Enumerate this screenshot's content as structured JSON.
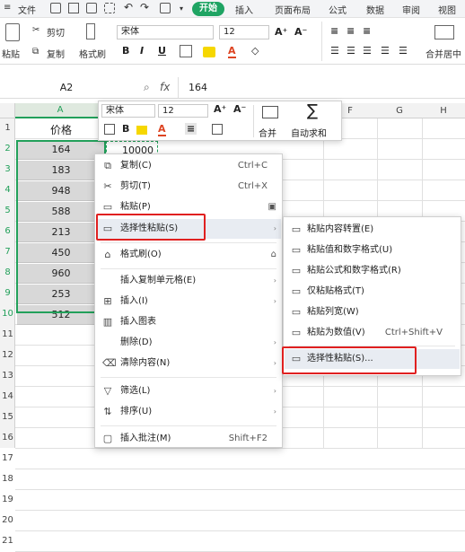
{
  "menubar": {
    "file": "文件",
    "start": "开始",
    "tabs": [
      "插入",
      "页面布局",
      "公式",
      "数据",
      "审阅",
      "视图"
    ]
  },
  "ribbon": {
    "paste_label": "粘贴",
    "cut_label": "剪切",
    "copy_label": "复制",
    "format_painter_label": "格式刷",
    "font_name": "宋体",
    "font_size": "12",
    "merge_label": "合并居中",
    "bold": "B",
    "italic": "I",
    "underline": "U",
    "font_size_up": "A⁺",
    "font_size_down": "A⁻",
    "font_color": "A"
  },
  "formula_bar": {
    "cell_ref": "A2",
    "fx": "fx",
    "value": "164"
  },
  "columns": [
    "A",
    "F",
    "G",
    "H"
  ],
  "rows": [
    "1",
    "2",
    "3",
    "4",
    "5",
    "6",
    "7",
    "8",
    "9",
    "10",
    "11",
    "12",
    "13",
    "14",
    "15",
    "16",
    "17",
    "18",
    "19",
    "20",
    "21"
  ],
  "column_a": {
    "header": "价格",
    "values": [
      "164",
      "183",
      "948",
      "588",
      "213",
      "450",
      "960",
      "253",
      "512"
    ]
  },
  "b2_value": "10000",
  "mini_toolbar": {
    "font": "宋体",
    "size": "12",
    "bold": "B",
    "font_color": "A",
    "merge": "合并",
    "autosum": "自动求和"
  },
  "context_menu": {
    "items": [
      {
        "label": "复制(C)",
        "shortcut": "Ctrl+C"
      },
      {
        "label": "剪切(T)",
        "shortcut": "Ctrl+X"
      },
      {
        "label": "粘贴(P)",
        "shortcut": ""
      },
      {
        "label": "选择性粘贴(S)",
        "shortcut": ""
      },
      {
        "label": "格式刷(O)",
        "shortcut": ""
      },
      {
        "label": "插入复制单元格(E)",
        "shortcut": ""
      },
      {
        "label": "插入(I)",
        "shortcut": ""
      },
      {
        "label": "插入图表",
        "shortcut": ""
      },
      {
        "label": "删除(D)",
        "shortcut": ""
      },
      {
        "label": "清除内容(N)",
        "shortcut": ""
      },
      {
        "label": "筛选(L)",
        "shortcut": ""
      },
      {
        "label": "排序(U)",
        "shortcut": ""
      },
      {
        "label": "插入批注(M)",
        "shortcut": "Shift+F2"
      }
    ]
  },
  "submenu": {
    "items": [
      {
        "label": "粘贴内容转置(E)",
        "shortcut": ""
      },
      {
        "label": "粘贴值和数字格式(U)",
        "shortcut": ""
      },
      {
        "label": "粘贴公式和数字格式(R)",
        "shortcut": ""
      },
      {
        "label": "仅粘贴格式(T)",
        "shortcut": ""
      },
      {
        "label": "粘贴列宽(W)",
        "shortcut": ""
      },
      {
        "label": "粘贴为数值(V)",
        "shortcut": "Ctrl+Shift+V"
      },
      {
        "label": "选择性粘贴(S)...",
        "shortcut": ""
      }
    ]
  },
  "colors": {
    "accent": "#1fa463",
    "highlight_border": "#e02020",
    "selection": "#22a05a"
  }
}
